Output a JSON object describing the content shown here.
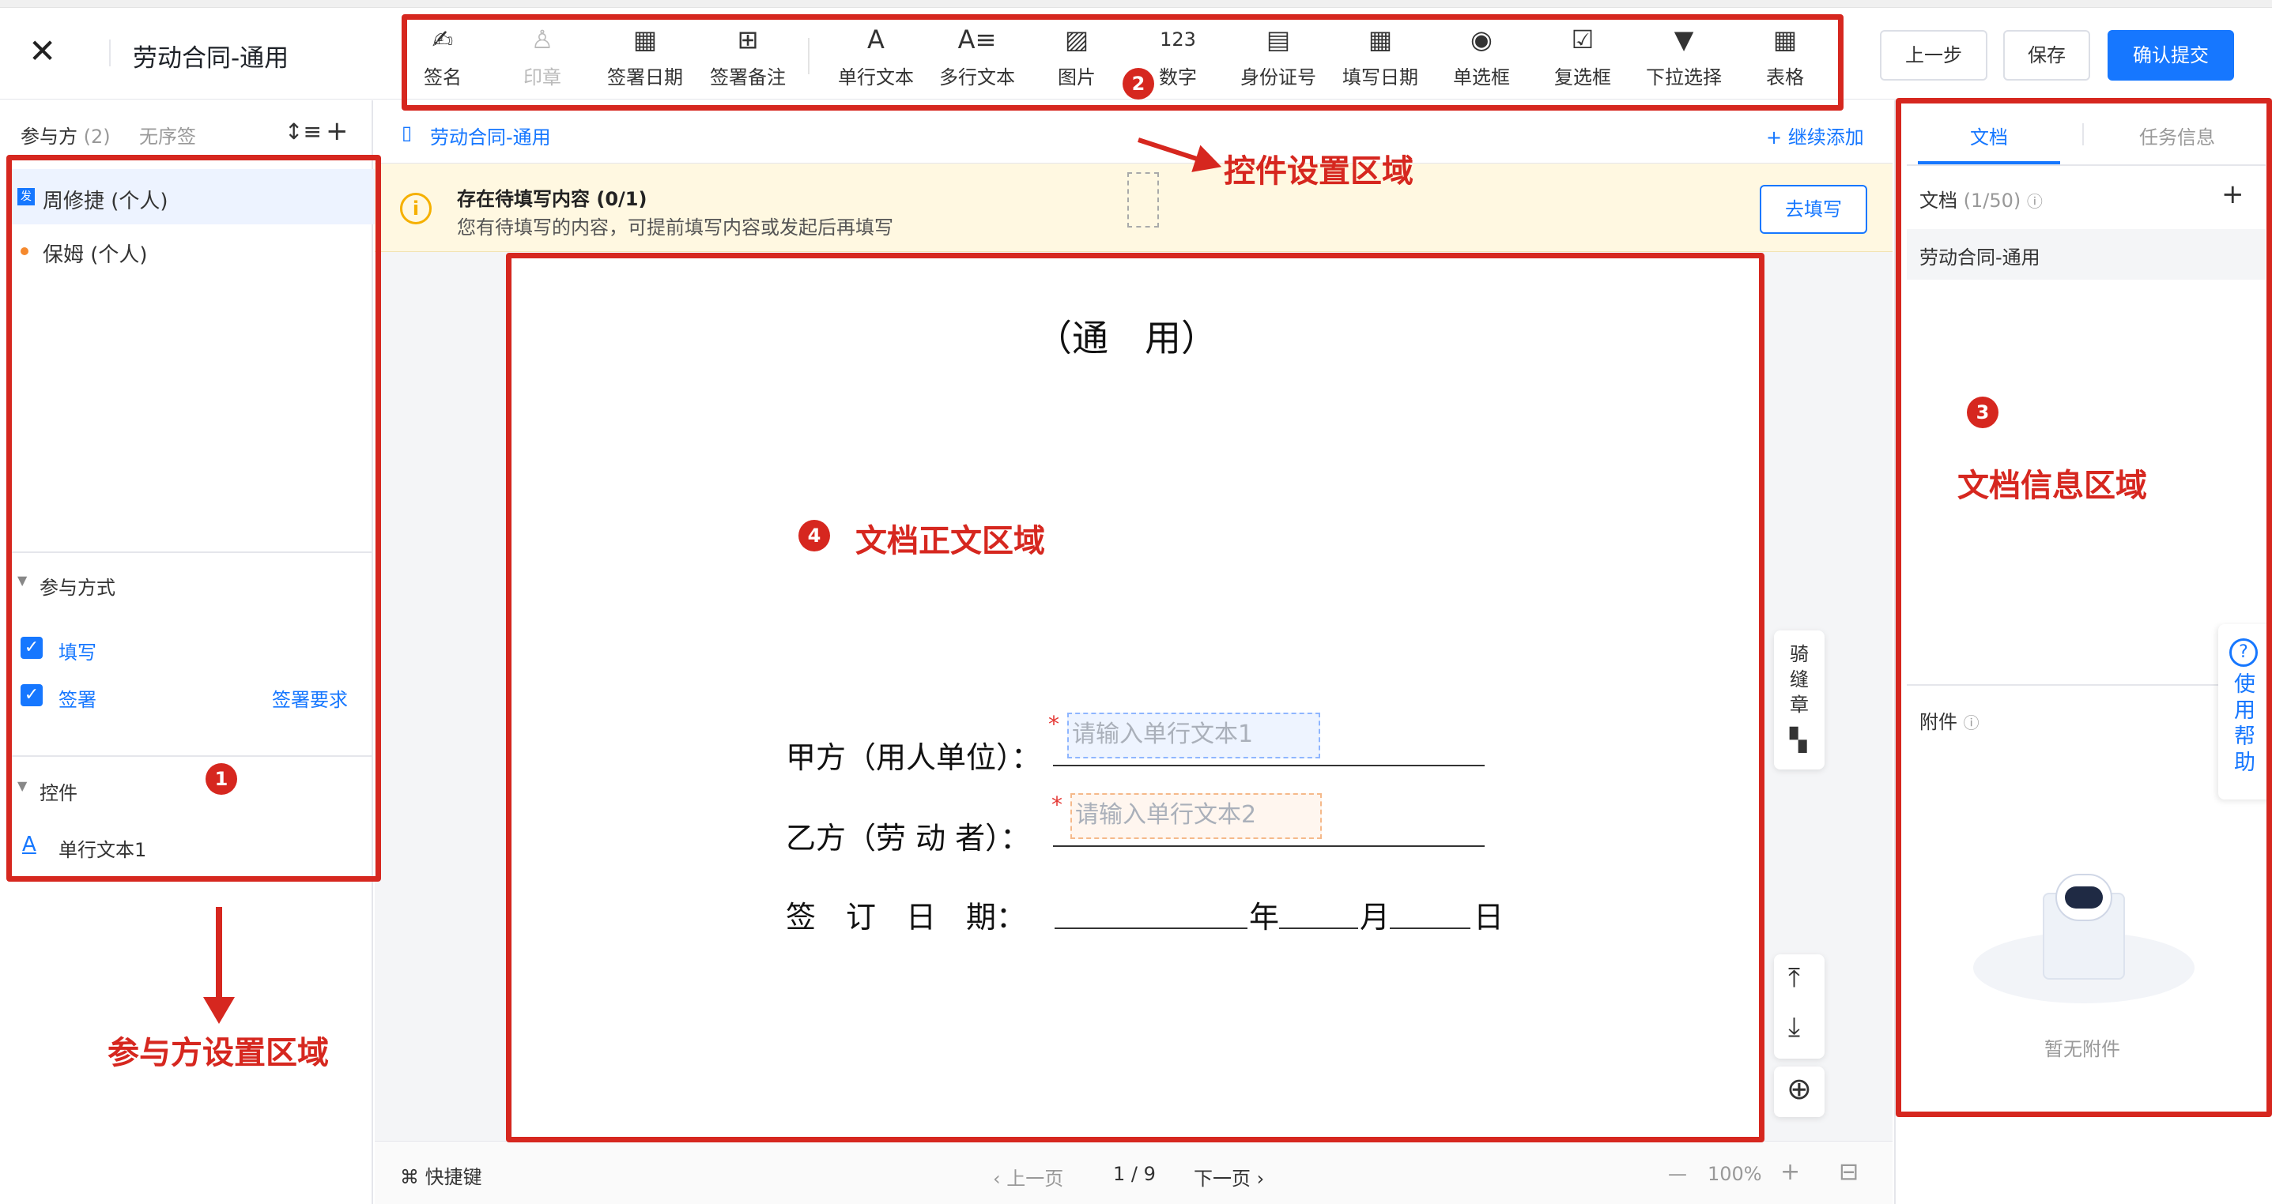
{
  "header": {
    "title": "劳动合同-通用",
    "buttons": {
      "prev": "上一步",
      "save": "保存",
      "submit": "确认提交"
    }
  },
  "toolbar": [
    {
      "label": "签名",
      "icon": "pen-sign-icon",
      "glyph": "✍"
    },
    {
      "label": "印章",
      "icon": "stamp-icon",
      "glyph": "♙",
      "disabled": true
    },
    {
      "label": "签署日期",
      "icon": "calendar-icon",
      "glyph": "▦"
    },
    {
      "label": "签署备注",
      "icon": "comment-plus-icon",
      "glyph": "⊞"
    },
    {
      "label": "单行文本",
      "icon": "text-a-icon",
      "glyph": "A"
    },
    {
      "label": "多行文本",
      "icon": "multiline-text-icon",
      "glyph": "A≡"
    },
    {
      "label": "图片",
      "icon": "image-icon",
      "glyph": "▨"
    },
    {
      "label": "数字",
      "icon": "number-icon",
      "glyph": "123"
    },
    {
      "label": "身份证号",
      "icon": "id-card-icon",
      "glyph": "▤"
    },
    {
      "label": "填写日期",
      "icon": "calendar-fill-icon",
      "glyph": "▦"
    },
    {
      "label": "单选框",
      "icon": "radio-icon",
      "glyph": "◉"
    },
    {
      "label": "复选框",
      "icon": "checkbox-icon",
      "glyph": "☑"
    },
    {
      "label": "下拉选择",
      "icon": "dropdown-icon",
      "glyph": "▼"
    },
    {
      "label": "表格",
      "icon": "table-icon",
      "glyph": "▦"
    }
  ],
  "annotations": {
    "b1": "1",
    "b2": "2",
    "b3": "3",
    "b4": "4",
    "control_area": "控件设置区域",
    "participant_area": "参与方设置区域",
    "docinfo_area": "文档信息区域",
    "body_area": "文档正文区域"
  },
  "left": {
    "participants_label": "参与方",
    "participants_count": "(2)",
    "no_order": "无序签",
    "participants": [
      {
        "tag": "发",
        "name": "周修捷 (个人)"
      },
      {
        "name": "保姆 (个人)"
      }
    ],
    "mode_title": "参与方式",
    "modes": [
      {
        "label": "填写"
      },
      {
        "label": "签署"
      }
    ],
    "sign_requirement": "签署要求",
    "controls_title": "控件",
    "controls": [
      {
        "label": "单行文本1"
      }
    ]
  },
  "main": {
    "doc_link": "劳动合同-通用",
    "continue_add": "+ 继续添加",
    "notice_title": "存在待填写内容 (0/1)",
    "notice_text": "您有待填写的内容，可提前填写内容或发起后再填写",
    "notice_button": "去填写",
    "doc_heading": "（通　用）",
    "party_a_label": "甲方（用人单位）：",
    "party_b_label": "乙方（劳 动 者）：",
    "sign_date_label": "签　订　日　期：",
    "year": "年",
    "month": "月",
    "day": "日",
    "field1_placeholder": "请输入单行文本1",
    "field2_placeholder": "请输入单行文本2",
    "required_mark": "*",
    "seam_seal": "骑缝章",
    "shortcut": "⌘ 快捷键",
    "prev_page": "‹ 上一页",
    "page": "1 / 9",
    "next_page": "下一页 ›",
    "zoom_minus": "—",
    "zoom": "100%",
    "zoom_plus": "+"
  },
  "right": {
    "tab_doc": "文档",
    "tab_task": "任务信息",
    "doc_label": "文档",
    "doc_count": "(1/50)",
    "doc_item": "劳动合同-通用",
    "attach_label": "附件",
    "no_attach": "暂无附件",
    "help": "使用帮助"
  },
  "colors": {
    "accent": "#1677ff",
    "annotation": "#d6271f",
    "notice_bg": "#fff8e1"
  }
}
